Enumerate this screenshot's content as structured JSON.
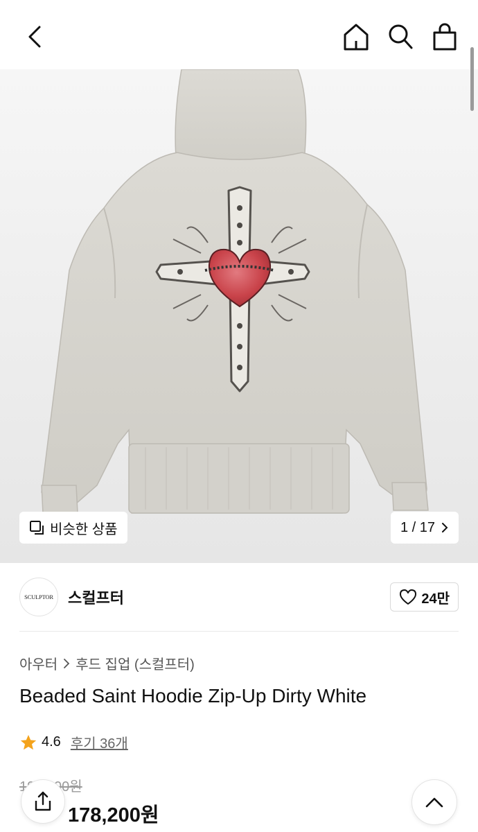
{
  "header": {
    "back_icon": "chevron-left-icon",
    "icons": [
      "home-icon",
      "search-icon",
      "shopping-bag-icon"
    ]
  },
  "gallery": {
    "similar_label": "비슷한 상품",
    "counter": "1 / 17",
    "colors": {
      "heart": "#c9434a",
      "hoodie": "#d9d7d1"
    }
  },
  "brand": {
    "logo_text": "SCULPTOR",
    "name": "스컬프터",
    "likes": "24만"
  },
  "breadcrumb": {
    "category": "아우터",
    "subcategory": "후드 집업 (스컬프터)"
  },
  "product": {
    "title": "Beaded Saint Hoodie Zip-Up Dirty White",
    "rating": "4.6",
    "reviews": "후기 36개",
    "original_price": "198,000원",
    "sale_price": "178,200원"
  },
  "colors": {
    "star": "#f4a31c",
    "text": "#111111",
    "muted": "#9a9a9a"
  }
}
